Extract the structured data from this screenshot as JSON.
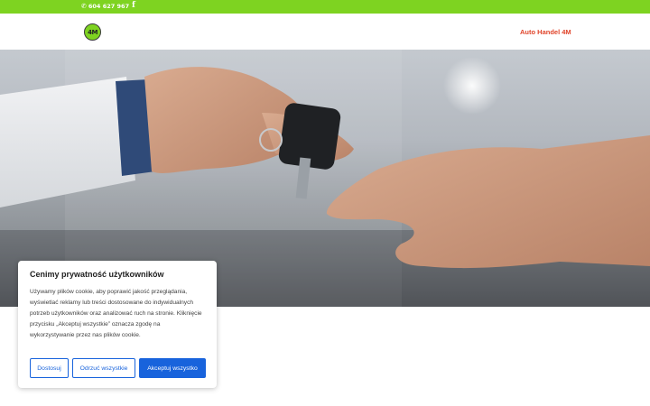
{
  "topbar": {
    "phone": "604 627 967",
    "phone_icon": "phone-icon",
    "facebook_icon": "facebook-icon",
    "bg_color": "#7ed321"
  },
  "header": {
    "logo_text": "4M",
    "nav_link": "Auto Handel 4M",
    "accent_color": "#e0452b"
  },
  "cookie_banner": {
    "title": "Cenimy prywatność użytkowników",
    "body": "Używamy plików cookie, aby poprawić jakość przeglądania, wyświetlać reklamy lub treści dostosowane do indywidualnych potrzeb użytkowników oraz analizować ruch na stronie. Kliknięcie przycisku „Akceptuj wszystkie” oznacza zgodę na wykorzystywanie przez nas plików cookie.",
    "buttons": {
      "customize": "Dostosuj",
      "reject": "Odrzuć wszystkie",
      "accept": "Akceptuj wszystko"
    },
    "button_color": "#1863dc"
  }
}
